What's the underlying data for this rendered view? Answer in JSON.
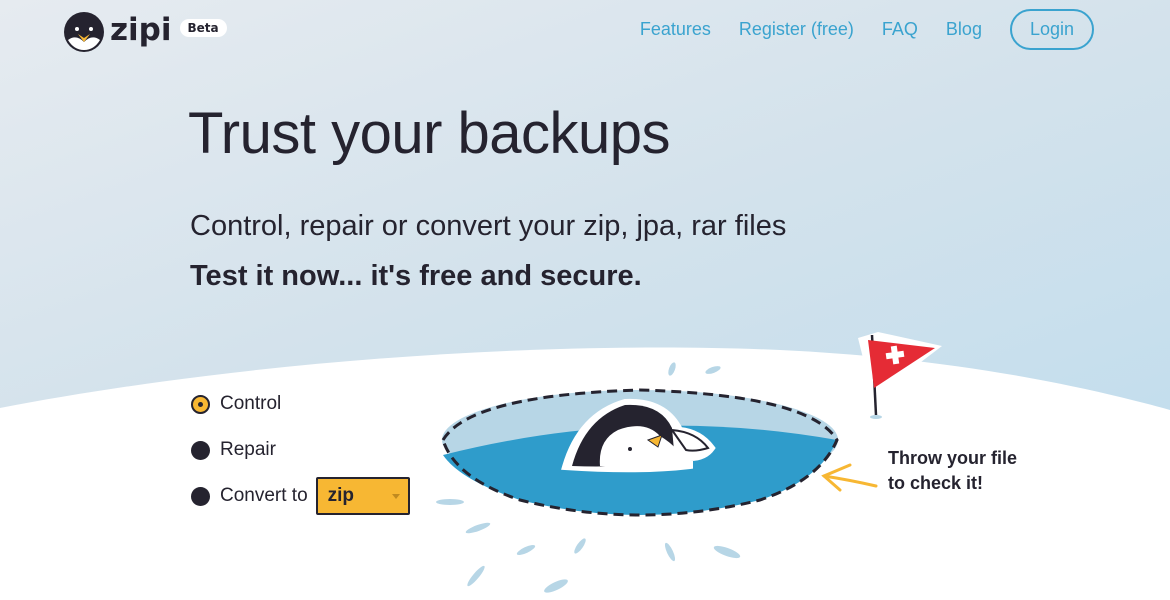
{
  "brand": {
    "name": "zipi",
    "badge": "Beta"
  },
  "nav": {
    "items": [
      {
        "label": "Features"
      },
      {
        "label": "Register (free)"
      },
      {
        "label": "FAQ"
      },
      {
        "label": "Blog"
      }
    ],
    "login_label": "Login"
  },
  "hero": {
    "title": "Trust your backups",
    "subtitle": "Control, repair or convert your zip, jpa, rar files",
    "tagline": "Test it now... it's free and secure."
  },
  "options": {
    "selected": "Control",
    "items": [
      {
        "label": "Control",
        "selected": true
      },
      {
        "label": "Repair",
        "selected": false
      },
      {
        "label": "Convert to",
        "selected": false
      }
    ],
    "convert_format": "zip"
  },
  "dropzone": {
    "callout_line1": "Throw your file",
    "callout_line2": "to check it!"
  },
  "colors": {
    "accent": "#3aa3cf",
    "dark": "#25232f",
    "yellow": "#f7b733",
    "water": "#2f9ccb",
    "ice": "#b7d6e6",
    "flag_red": "#e52b35"
  }
}
